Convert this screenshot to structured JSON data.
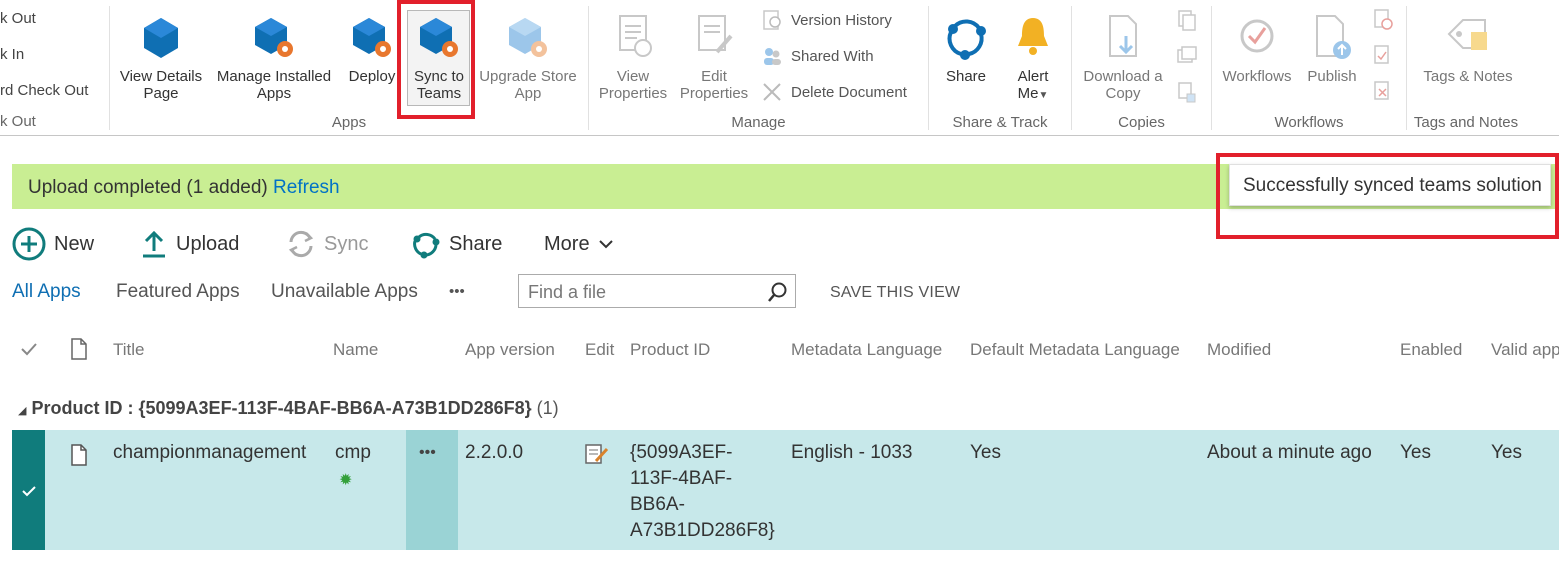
{
  "ribbon": {
    "check_out": "k Out",
    "check_in": "k In",
    "discard_check_out": "rd Check Out",
    "check_out2": "k Out",
    "view_details": "View Details Page",
    "manage_installed": "Manage Installed Apps",
    "deploy": "Deploy",
    "sync_to_teams": "Sync to Teams",
    "upgrade_store": "Upgrade Store App",
    "apps_group": "Apps",
    "view_properties": "View Properties",
    "edit_properties": "Edit Properties",
    "version_history": "Version History",
    "shared_with": "Shared With",
    "delete_document": "Delete Document",
    "manage_group": "Manage",
    "share": "Share",
    "alert_me": "Alert Me",
    "share_track_group": "Share & Track",
    "download_copy": "Download a Copy",
    "copies_group": "Copies",
    "workflows": "Workflows",
    "publish": "Publish",
    "workflows_group": "Workflows",
    "tags_notes": "Tags & Notes",
    "tags_notes_group": "Tags and Notes"
  },
  "message": {
    "text": "Upload completed (1 added)",
    "link": "Refresh"
  },
  "toast": "Successfully synced teams solution",
  "commands": {
    "new": "New",
    "upload": "Upload",
    "sync": "Sync",
    "share": "Share",
    "more": "More"
  },
  "views": {
    "all": "All Apps",
    "featured": "Featured Apps",
    "unavailable": "Unavailable Apps",
    "ellipsis": "•••",
    "search_placeholder": "Find a file",
    "save_view": "SAVE THIS VIEW"
  },
  "columns": [
    "Title",
    "Name",
    "App version",
    "Edit",
    "Product ID",
    "Metadata Language",
    "Default Metadata Language",
    "Modified",
    "Enabled",
    "Valid app"
  ],
  "group": {
    "label": "Product ID :",
    "value": "{5099A3EF-113F-4BAF-BB6A-A73B1DD286F8}",
    "count": "(1)"
  },
  "row": {
    "title": "championmanagement",
    "name": "cmp",
    "menu": "•••",
    "version": "2.2.0.0",
    "product_id_lines": [
      "{5099A3EF-",
      "113F-4BAF-",
      "BB6A-",
      "A73B1DD286F8}"
    ],
    "metadata_language": "English - 1033",
    "default_metadata": "Yes",
    "modified": "About a minute ago",
    "enabled": "Yes",
    "valid": "Yes"
  },
  "colors": {
    "accent_blue": "#0f6fb3",
    "highlight_red": "#e2202b",
    "message_green": "#c9ee93",
    "row_teal": "#c7e8ea",
    "select_teal": "#107c7c"
  }
}
